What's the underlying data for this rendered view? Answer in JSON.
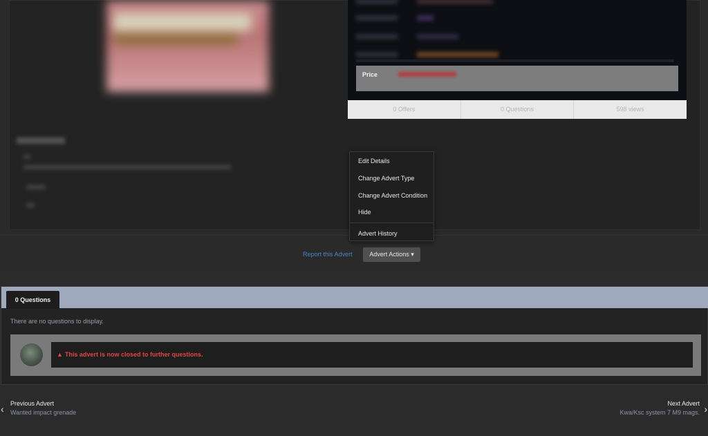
{
  "details": {
    "price_label": "Price"
  },
  "stats": {
    "offers": "0 Offers",
    "questions": "0 Questions",
    "views": "598 views"
  },
  "actions": {
    "report_link": "Report this Advert",
    "advert_actions_button": "Advert Actions ▾"
  },
  "dropdown": {
    "items": [
      "Edit Details",
      "Change Advert Type",
      "Change Advert Condition",
      "Hide",
      "Advert History"
    ]
  },
  "questions": {
    "tab_label": "0 Questions",
    "empty_text": "There are no questions to display.",
    "closed_icon": "▲",
    "closed_text": "This advert is now closed to further questions."
  },
  "pager": {
    "prev_arrow": "‹",
    "prev_label": "Previous Advert",
    "prev_title": "Wanted impact grenade",
    "next_arrow": "›",
    "next_label": "Next Advert",
    "next_title": "Kwa/Ksc system 7 M9 mags."
  },
  "colors": {
    "accent_link": "#4a86c5",
    "warning": "#e04444",
    "tab_bar": "#9fa9bd"
  }
}
